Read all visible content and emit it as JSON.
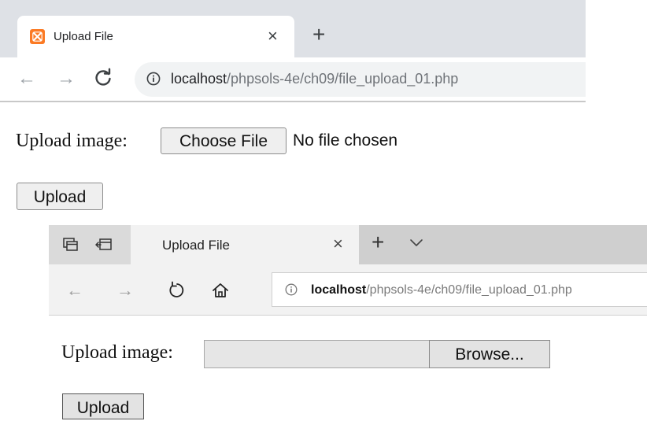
{
  "chrome": {
    "tab_title": "Upload File",
    "tab_close": "×",
    "new_tab": "+",
    "back": "←",
    "forward": "→",
    "url_host": "localhost",
    "url_path": "/phpsols-4e/ch09/file_upload_01.php",
    "favicon_color": "#fb7a24",
    "icons": [
      "xampp-favicon",
      "reload-icon",
      "info-icon"
    ],
    "page": {
      "label": "Upload image:",
      "choose_file_label": "Choose File",
      "file_status": "No file chosen",
      "upload_button": "Upload"
    }
  },
  "edge": {
    "tab_title": "Upload File",
    "tab_close": "×",
    "new_tab": "+",
    "back": "←",
    "forward": "→",
    "url_host": "localhost",
    "url_path": "/phpsols-4e/ch09/file_upload_01.php",
    "icons": [
      "set-tabs-aside-icon",
      "tab-preview-icon",
      "chevron-down-icon",
      "refresh-icon",
      "home-icon",
      "info-icon"
    ],
    "page": {
      "label": "Upload image:",
      "file_value": "",
      "browse_label": "Browse...",
      "upload_button": "Upload"
    }
  }
}
